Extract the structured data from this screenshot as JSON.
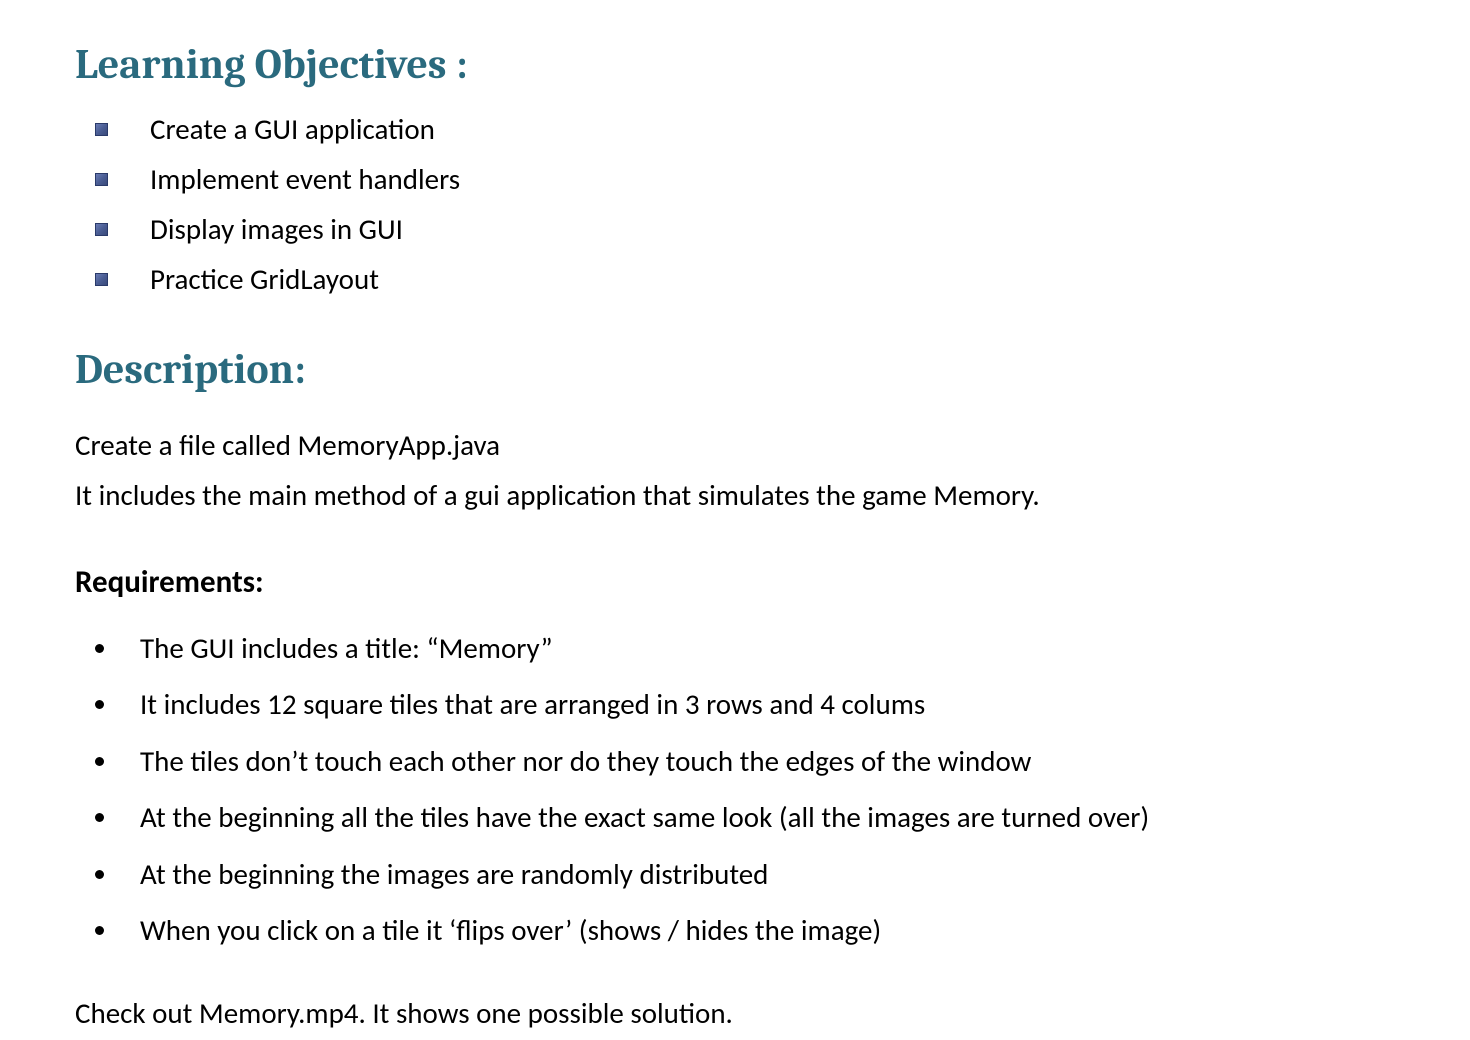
{
  "heading_objectives": "Learning Objectives :",
  "objectives": [
    "Create a GUI application",
    "Implement event handlers",
    "Display images in GUI",
    "Practice GridLayout"
  ],
  "heading_description": "Description:",
  "description_lines": [
    "Create a file called MemoryApp.java",
    "It includes the main method of a gui application that simulates the game Memory."
  ],
  "subheading_requirements": "Requirements:",
  "requirements": [
    "The GUI includes a title:  “Memory”",
    "It includes 12 square tiles that are arranged in 3 rows and 4 colums",
    "The tiles don’t touch each other nor do they touch the edges of the window",
    "At the beginning all the tiles have the exact same look (all the images are turned over)",
    "At the beginning the images are randomly distributed",
    "When you click on a tile it ‘flips over’ (shows / hides the image)"
  ],
  "closing": "Check out Memory.mp4. It shows one possible solution."
}
